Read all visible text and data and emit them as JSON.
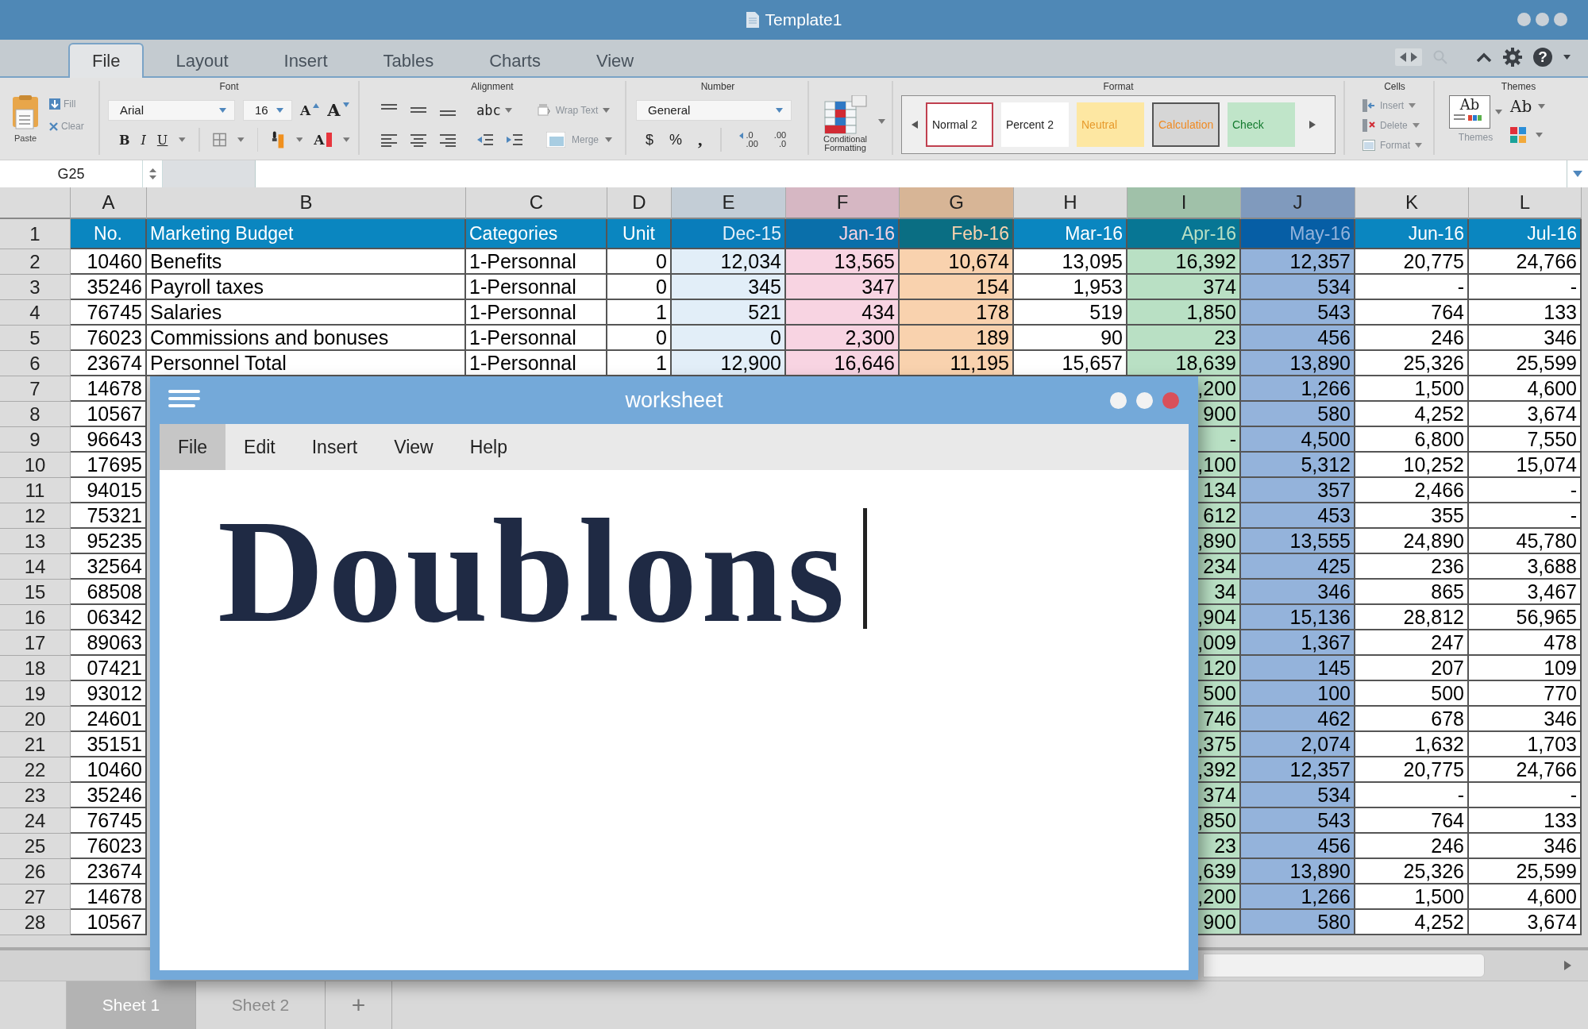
{
  "app_window": {
    "title": "Template1"
  },
  "tabs": [
    {
      "label": "File",
      "selected": true
    },
    {
      "label": "Layout",
      "selected": false
    },
    {
      "label": "Insert",
      "selected": false
    },
    {
      "label": "Tables",
      "selected": false
    },
    {
      "label": "Charts",
      "selected": false
    },
    {
      "label": "View",
      "selected": false
    }
  ],
  "toolbar": {
    "help": "?"
  },
  "ribbon": {
    "clipboard": {
      "paste": "Paste",
      "fill": "Fill",
      "clear": "Clear"
    },
    "font": {
      "label": "Font",
      "family": "Arial",
      "size": "16",
      "grow": "A",
      "shrink": "A",
      "bold": "B",
      "italic": "I",
      "underline": "U",
      "font_color": "A"
    },
    "alignment": {
      "label": "Alignment",
      "orientation": "abc",
      "wrap_text": "Wrap Text",
      "merge": "Merge"
    },
    "number": {
      "label": "Number",
      "format": "General",
      "currency": "$",
      "percent": "%",
      "comma": ",",
      "increase_decimal": [
        ".0",
        ".00"
      ],
      "decrease_decimal": [
        ".00",
        ".0"
      ]
    },
    "conditional_formatting": "Conditional Formatting",
    "format": {
      "label": "Format",
      "styles": [
        {
          "label": "Normal 2",
          "kind": "normal"
        },
        {
          "label": "Percent 2",
          "kind": "percent"
        },
        {
          "label": "Neutral",
          "kind": "neutral"
        },
        {
          "label": "Calculation",
          "kind": "calculation"
        },
        {
          "label": "Check",
          "kind": "check"
        }
      ]
    },
    "cells": {
      "label": "Cells",
      "items": [
        {
          "label": "Insert",
          "kind": "insert"
        },
        {
          "label": "Delete",
          "kind": "delete"
        },
        {
          "label": "Format",
          "kind": "format"
        }
      ]
    },
    "themes": {
      "label": "Themes",
      "thumbnail": "Ab",
      "caption": "Themes",
      "fonts": "Ab"
    }
  },
  "formula_bar": {
    "name_box": "G25"
  },
  "sheet": {
    "columns": [
      {
        "letter": "A"
      },
      {
        "letter": "B"
      },
      {
        "letter": "C"
      },
      {
        "letter": "D"
      },
      {
        "letter": "E",
        "color": "#e2eef8"
      },
      {
        "letter": "F",
        "color": "#f8d4e2"
      },
      {
        "letter": "G",
        "color": "#f9d2ae"
      },
      {
        "letter": "H"
      },
      {
        "letter": "I",
        "color": "#b9e0c4"
      },
      {
        "letter": "J",
        "color": "#94b3db"
      },
      {
        "letter": "K"
      },
      {
        "letter": "L"
      }
    ],
    "rows": [
      {
        "number": "1",
        "kind": "header",
        "cells": {
          "A": "No.",
          "B": "Marketing Budget",
          "C": "Categories",
          "D": "Unit",
          "E": "Dec-15",
          "F": "Jan-16",
          "G": "Feb-16",
          "H": "Mar-16",
          "I": "Apr-16",
          "J": "May-16",
          "K": "Jun-16",
          "L": "Jul-16"
        }
      },
      {
        "number": "2",
        "kind": "data",
        "cells": {
          "A": "10460",
          "B": "Benefits",
          "C": "1-Personnal",
          "D": "0",
          "E": "12,034",
          "F": "13,565",
          "G": "10,674",
          "H": "13,095",
          "I": "16,392",
          "J": "12,357",
          "K": "20,775",
          "L": "24,766"
        }
      },
      {
        "number": "3",
        "kind": "data",
        "cells": {
          "A": "35246",
          "B": "Payroll taxes",
          "C": "1-Personnal",
          "D": "0",
          "E": "345",
          "F": "347",
          "G": "154",
          "H": "1,953",
          "I": "374",
          "J": "534",
          "K": "-",
          "L": "-"
        }
      },
      {
        "number": "4",
        "kind": "data",
        "cells": {
          "A": "76745",
          "B": "Salaries",
          "C": "1-Personnal",
          "D": "1",
          "E": "521",
          "F": "434",
          "G": "178",
          "H": "519",
          "I": "1,850",
          "J": "543",
          "K": "764",
          "L": "133"
        }
      },
      {
        "number": "5",
        "kind": "data",
        "cells": {
          "A": "76023",
          "B": "Commissions and bonuses",
          "C": "1-Personnal",
          "D": "0",
          "E": "0",
          "F": "2,300",
          "G": "189",
          "H": "90",
          "I": "23",
          "J": "456",
          "K": "246",
          "L": "346"
        }
      },
      {
        "number": "6",
        "kind": "data",
        "cells": {
          "A": "23674",
          "B": "Personnel Total",
          "C": "1-Personnal",
          "D": "1",
          "E": "12,900",
          "F": "16,646",
          "G": "11,195",
          "H": "15,657",
          "I": "18,639",
          "J": "13,890",
          "K": "25,326",
          "L": "25,599"
        }
      },
      {
        "number": "7",
        "kind": "data",
        "cells": {
          "A": "14678",
          "I": ",200",
          "J": "1,266",
          "K": "1,500",
          "L": "4,600"
        }
      },
      {
        "number": "8",
        "kind": "data",
        "cells": {
          "A": "10567",
          "I": "900",
          "J": "580",
          "K": "4,252",
          "L": "3,674"
        }
      },
      {
        "number": "9",
        "kind": "data",
        "cells": {
          "A": "96643",
          "I": "-",
          "J": "4,500",
          "K": "6,800",
          "L": "7,550"
        }
      },
      {
        "number": "10",
        "kind": "data",
        "cells": {
          "A": "17695",
          "I": ",100",
          "J": "5,312",
          "K": "10,252",
          "L": "15,074"
        }
      },
      {
        "number": "11",
        "kind": "data",
        "cells": {
          "A": "94015",
          "I": "134",
          "J": "357",
          "K": "2,466",
          "L": "-"
        }
      },
      {
        "number": "12",
        "kind": "data",
        "cells": {
          "A": "75321",
          "I": "612",
          "J": "453",
          "K": "355",
          "L": "-"
        }
      },
      {
        "number": "13",
        "kind": "data",
        "cells": {
          "A": "95235",
          "I": ",890",
          "J": "13,555",
          "K": "24,890",
          "L": "45,780"
        }
      },
      {
        "number": "14",
        "kind": "data",
        "cells": {
          "A": "32564",
          "I": "234",
          "J": "425",
          "K": "236",
          "L": "3,688"
        }
      },
      {
        "number": "15",
        "kind": "data",
        "cells": {
          "A": "68508",
          "I": "34",
          "J": "346",
          "K": "865",
          "L": "3,467"
        }
      },
      {
        "number": "16",
        "kind": "data",
        "cells": {
          "A": "06342",
          "I": ",904",
          "J": "15,136",
          "K": "28,812",
          "L": "56,965"
        }
      },
      {
        "number": "17",
        "kind": "data",
        "cells": {
          "A": "89063",
          "I": ",009",
          "J": "1,367",
          "K": "247",
          "L": "478"
        }
      },
      {
        "number": "18",
        "kind": "data",
        "cells": {
          "A": "07421",
          "I": "120",
          "J": "145",
          "K": "207",
          "L": "109"
        }
      },
      {
        "number": "19",
        "kind": "data",
        "cells": {
          "A": "93012",
          "I": "500",
          "J": "100",
          "K": "500",
          "L": "770"
        }
      },
      {
        "number": "20",
        "kind": "data",
        "cells": {
          "A": "24601",
          "I": "746",
          "J": "462",
          "K": "678",
          "L": "346"
        }
      },
      {
        "number": "21",
        "kind": "data",
        "cells": {
          "A": "35151",
          "I": ",375",
          "J": "2,074",
          "K": "1,632",
          "L": "1,703"
        }
      },
      {
        "number": "22",
        "kind": "data",
        "cells": {
          "A": "10460",
          "I": ",392",
          "J": "12,357",
          "K": "20,775",
          "L": "24,766"
        }
      },
      {
        "number": "23",
        "kind": "data",
        "cells": {
          "A": "35246",
          "I": "374",
          "J": "534",
          "K": "-",
          "L": "-"
        }
      },
      {
        "number": "24",
        "kind": "data",
        "cells": {
          "A": "76745",
          "I": ",850",
          "J": "543",
          "K": "764",
          "L": "133"
        }
      },
      {
        "number": "25",
        "kind": "data",
        "cells": {
          "A": "76023",
          "I": "23",
          "J": "456",
          "K": "246",
          "L": "346"
        }
      },
      {
        "number": "26",
        "kind": "data",
        "cells": {
          "A": "23674",
          "I": ",639",
          "J": "13,890",
          "K": "25,326",
          "L": "25,599"
        }
      },
      {
        "number": "27",
        "kind": "data",
        "cells": {
          "A": "14678",
          "I": ",200",
          "J": "1,266",
          "K": "1,500",
          "L": "4,600"
        }
      },
      {
        "number": "28",
        "kind": "data",
        "cells": {
          "A": "10567",
          "I": "900",
          "J": "580",
          "K": "4,252",
          "L": "3,674"
        }
      }
    ]
  },
  "sheet_tabs": [
    {
      "label": "Sheet 1",
      "selected": true
    },
    {
      "label": "Sheet 2",
      "selected": false
    }
  ],
  "add_sheet": "+",
  "editor_window": {
    "title": "worksheet",
    "menu": [
      {
        "label": "File",
        "selected": true
      },
      {
        "label": "Edit",
        "selected": false
      },
      {
        "label": "Insert",
        "selected": false
      },
      {
        "label": "View",
        "selected": false
      },
      {
        "label": "Help",
        "selected": false
      }
    ],
    "content": "Doublons"
  }
}
